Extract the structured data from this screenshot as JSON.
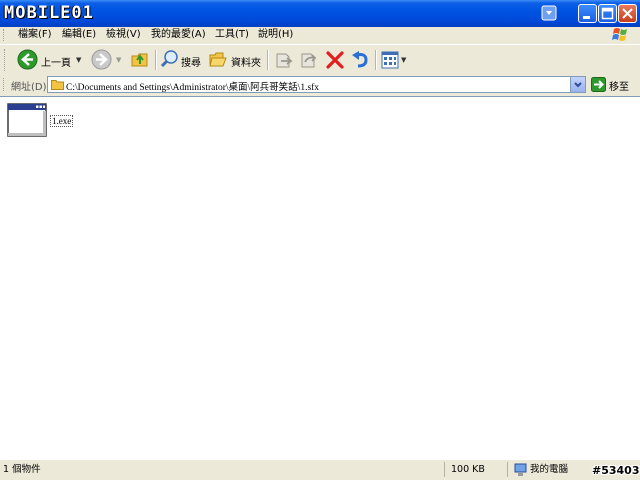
{
  "titlebar": {
    "logo_text": "MOBILE01"
  },
  "menubar": {
    "items": [
      {
        "label": "檔案(F)"
      },
      {
        "label": "編輯(E)"
      },
      {
        "label": "檢視(V)"
      },
      {
        "label": "我的最愛(A)"
      },
      {
        "label": "工具(T)"
      },
      {
        "label": "說明(H)"
      }
    ]
  },
  "toolbar": {
    "back_label": "上一頁",
    "search_label": "搜尋",
    "folders_label": "資料夾"
  },
  "address": {
    "label": "網址(D)",
    "path": "C:\\Documents and Settings\\Administrator\\桌面\\阿兵哥笑話\\1.sfx",
    "go_label": "移至"
  },
  "files": [
    {
      "name": "1.exe"
    }
  ],
  "statusbar": {
    "object_count": "1 個物件",
    "size": "100 KB",
    "location": "我的電腦"
  },
  "watermark": "#53403",
  "colors": {
    "titlebar": "#0054e3",
    "chrome": "#ece9d8",
    "delete_red": "#e02020",
    "back_green": "#2e9a2e"
  }
}
